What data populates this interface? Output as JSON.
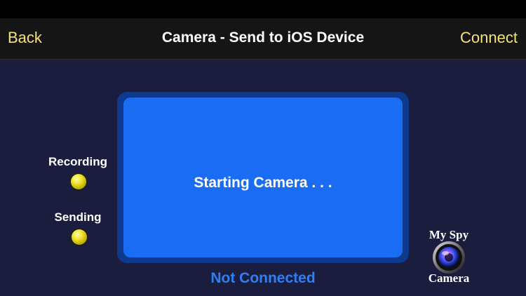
{
  "nav": {
    "back_label": "Back",
    "title": "Camera - Send to iOS Device",
    "connect_label": "Connect"
  },
  "indicators": {
    "recording_label": "Recording",
    "sending_label": "Sending"
  },
  "preview": {
    "status_text": "Starting Camera . . ."
  },
  "connection": {
    "status": "Not Connected"
  },
  "logo": {
    "line1": "My Spy",
    "line2": "Camera"
  },
  "icons": {
    "recording_led": "yellow-led-icon",
    "sending_led": "yellow-led-icon",
    "logo_lens": "camera-lens-icon"
  },
  "colors": {
    "nav_accent": "#f3e27a",
    "background": "#1b1d3e",
    "preview_blue": "#1a6df2",
    "status_blue": "#2f7ff3",
    "led_yellow": "#f3e32a"
  }
}
